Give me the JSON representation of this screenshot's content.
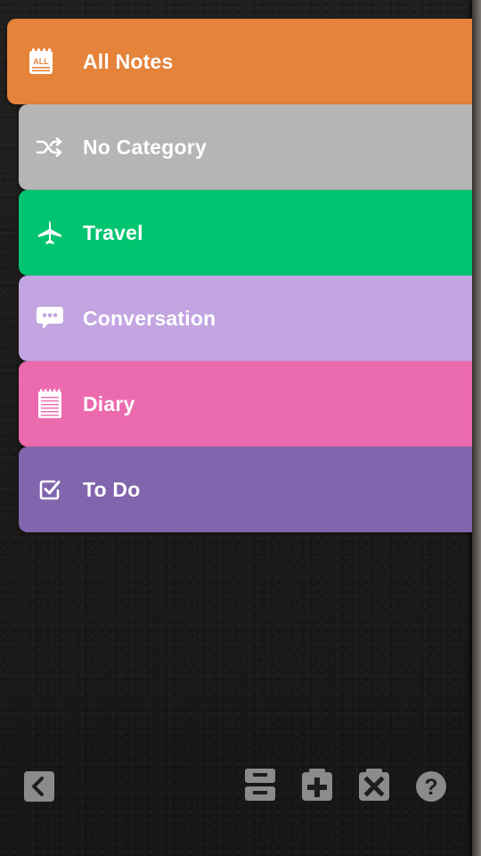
{
  "categories": [
    {
      "label": "All Notes",
      "color": "#e5833a",
      "icon": "all-notes-icon"
    },
    {
      "label": "No Category",
      "color": "#b5b5b5",
      "icon": "shuffle-icon"
    },
    {
      "label": "Travel",
      "color": "#00c46f",
      "icon": "airplane-icon"
    },
    {
      "label": "Conversation",
      "color": "#c2a5e1",
      "icon": "speech-bubble-icon"
    },
    {
      "label": "Diary",
      "color": "#ec6aae",
      "icon": "notepad-icon"
    },
    {
      "label": "To Do",
      "color": "#8165ad",
      "icon": "checkbox-icon"
    }
  ],
  "all_notes_badge": "ALL",
  "toolbar": {
    "icons": [
      "back-icon",
      "sort-icon",
      "add-category-icon",
      "delete-category-icon",
      "help-icon"
    ],
    "help_glyph": "?"
  }
}
